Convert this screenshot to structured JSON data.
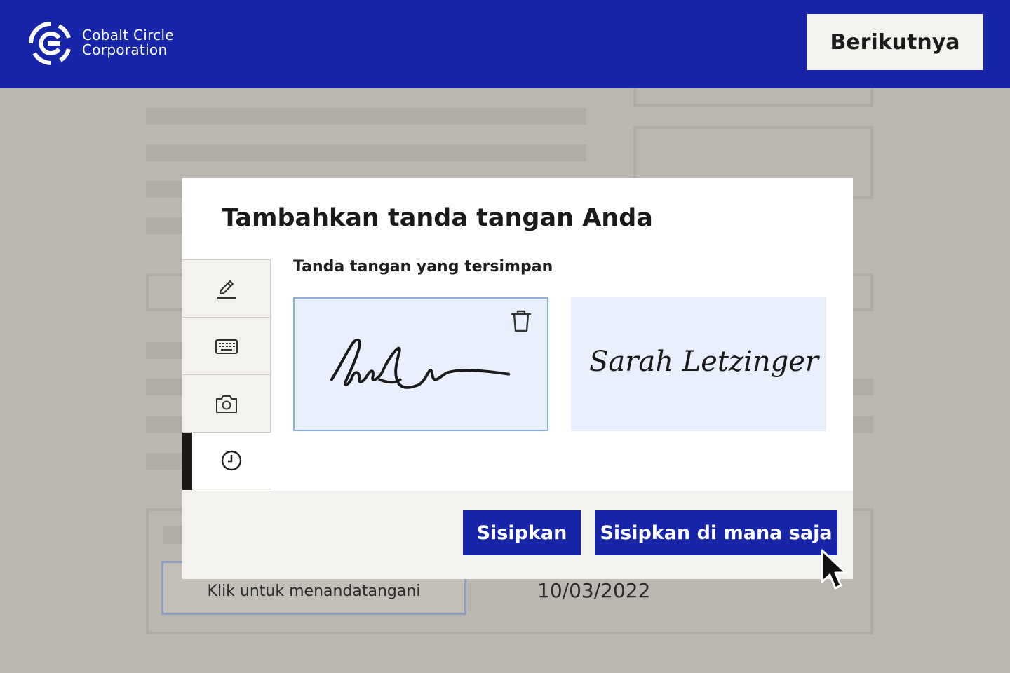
{
  "header": {
    "brand_line1": "Cobalt Circle",
    "brand_line2": "Corporation",
    "next_button": "Berikutnya",
    "logo_icon": "circle-logo-icon"
  },
  "document": {
    "sign_field_label": "Klik untuk menandatangani",
    "date": "10/03/2022"
  },
  "modal": {
    "title": "Tambahkan tanda tangan Anda",
    "saved_label": "Tanda tangan yang tersimpan",
    "tabs": [
      {
        "icon": "pen-icon",
        "active": false
      },
      {
        "icon": "keyboard-icon",
        "active": false
      },
      {
        "icon": "camera-icon",
        "active": false
      },
      {
        "icon": "clock-icon",
        "active": true
      }
    ],
    "signatures": [
      {
        "type": "drawn",
        "selected": true
      },
      {
        "type": "typed",
        "text": "Sarah Letzinger",
        "selected": false
      }
    ],
    "insert_button": "Sisipkan",
    "insert_anywhere_button": "Sisipkan di mana saja"
  },
  "colors": {
    "brand": "#1726a9",
    "selected_card": "#e9effd",
    "selected_border": "#8cb0e0"
  }
}
